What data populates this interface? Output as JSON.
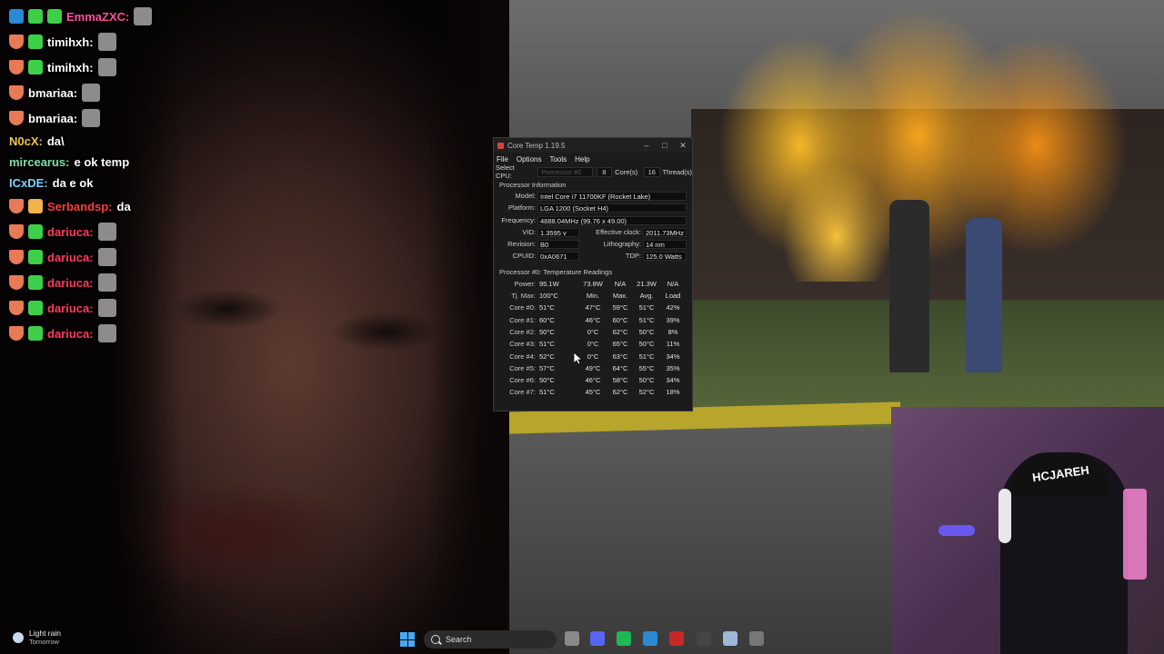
{
  "chat": {
    "lines": [
      {
        "user": "EmmaZXC:",
        "message": "",
        "color": "#ff4fa0"
      },
      {
        "user": "timihxh:",
        "message": "",
        "color": "#ffffff"
      },
      {
        "user": "timihxh:",
        "message": "",
        "color": "#ffffff"
      },
      {
        "user": "bmariaa:",
        "message": "",
        "color": "#ffffff"
      },
      {
        "user": "bmariaa:",
        "message": "",
        "color": "#ffffff"
      },
      {
        "user": "N0cX:",
        "message": "da\\",
        "color": "#f2c84b"
      },
      {
        "user": "mircearus:",
        "message": "e ok temp",
        "color": "#7fe0a8"
      },
      {
        "user": "ICxDE:",
        "message": "da e ok",
        "color": "#7fd3ff"
      },
      {
        "user": "Serbandsp:",
        "message": "da",
        "color": "#ff3b3b"
      },
      {
        "user": "dariuca:",
        "message": "",
        "color": "#ff3b5c"
      },
      {
        "user": "dariuca:",
        "message": "",
        "color": "#ff3b5c"
      },
      {
        "user": "dariuca:",
        "message": "",
        "color": "#ff3b5c"
      },
      {
        "user": "dariuca:",
        "message": "",
        "color": "#ff3b5c"
      },
      {
        "user": "dariuca:",
        "message": "",
        "color": "#ff3b5c"
      }
    ]
  },
  "coretemp": {
    "title": "Core Temp 1.19.5",
    "menu": [
      "File",
      "Options",
      "Tools",
      "Help"
    ],
    "select_cpu_label": "Select CPU:",
    "processor_select": "Processor #0",
    "cores_value": "8",
    "cores_label": "Core(s)",
    "threads_value": "16",
    "threads_label": "Thread(s)",
    "info_heading": "Processor Information",
    "model_label": "Model:",
    "model": "Intel Core i7 11700KF (Rocket Lake)",
    "platform_label": "Platform:",
    "platform": "LGA 1200 (Socket H4)",
    "frequency_label": "Frequency:",
    "frequency": "4888.04MHz (99.76 x 49.00)",
    "vid_label": "VID:",
    "vid": "1.3595 v",
    "effclock_label": "Effective clock:",
    "effclock": "2011.73MHz",
    "revision_label": "Revision:",
    "revision": "B0",
    "litho_label": "Lithography:",
    "litho": "14 nm",
    "cpuid_label": "CPUID:",
    "cpuid": "0xA0671",
    "tdp_label": "TDP:",
    "tdp": "125.0 Watts",
    "temps_heading": "Processor #0: Temperature Readings",
    "power_label": "Power:",
    "power": [
      "95.1W",
      "73.8W",
      "N/A",
      "21.3W",
      "N/A"
    ],
    "tjmax_label": "Tj. Max:",
    "tjmax": "100°C",
    "col_headers": [
      "Min.",
      "Max.",
      "Avg.",
      "Load"
    ],
    "cores": [
      {
        "label": "Core #0:",
        "cur": "51°C",
        "min": "47°C",
        "max": "59°C",
        "avg": "51°C",
        "load": "42%"
      },
      {
        "label": "Core #1:",
        "cur": "60°C",
        "min": "46°C",
        "max": "60°C",
        "avg": "51°C",
        "load": "39%"
      },
      {
        "label": "Core #2:",
        "cur": "50°C",
        "min": "0°C",
        "max": "62°C",
        "avg": "50°C",
        "load": "8%"
      },
      {
        "label": "Core #3:",
        "cur": "51°C",
        "min": "0°C",
        "max": "65°C",
        "avg": "50°C",
        "load": "11%"
      },
      {
        "label": "Core #4:",
        "cur": "52°C",
        "min": "0°C",
        "max": "63°C",
        "avg": "51°C",
        "load": "34%"
      },
      {
        "label": "Core #5:",
        "cur": "57°C",
        "min": "49°C",
        "max": "64°C",
        "avg": "55°C",
        "load": "35%"
      },
      {
        "label": "Core #6:",
        "cur": "50°C",
        "min": "46°C",
        "max": "58°C",
        "avg": "50°C",
        "load": "34%"
      },
      {
        "label": "Core #7:",
        "cur": "51°C",
        "min": "45°C",
        "max": "62°C",
        "avg": "52°C",
        "load": "18%"
      }
    ]
  },
  "webcam": {
    "cap_text": "HCJAREH"
  },
  "taskbar": {
    "weather_title": "Light rain",
    "weather_sub": "Tomorrow",
    "search_label": "Search",
    "apps": [
      {
        "name": "file-explorer-icon",
        "color": "#8a8a8a"
      },
      {
        "name": "discord-icon",
        "color": "#5865f2"
      },
      {
        "name": "spotify-icon",
        "color": "#1db954"
      },
      {
        "name": "edge-icon",
        "color": "#2a8ad6"
      },
      {
        "name": "app-red-icon",
        "color": "#c62828"
      },
      {
        "name": "obs-icon",
        "color": "#444444"
      },
      {
        "name": "window-icon",
        "color": "#9fb8d8"
      },
      {
        "name": "app-misc-icon",
        "color": "#777777"
      }
    ]
  }
}
